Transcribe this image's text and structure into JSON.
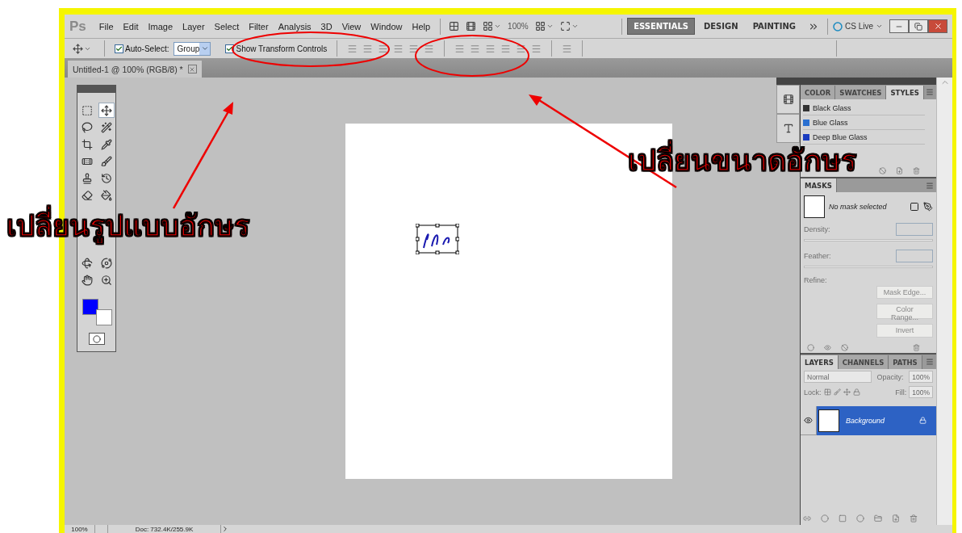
{
  "menu_bar": {
    "logo": "Ps",
    "items": [
      "File",
      "Edit",
      "Image",
      "Layer",
      "Select",
      "Filter",
      "Analysis",
      "3D",
      "View",
      "Window",
      "Help"
    ],
    "zoom": "100%",
    "workspaces": [
      {
        "label": "ESSENTIALS",
        "selected": true
      },
      {
        "label": "DESIGN",
        "selected": false
      },
      {
        "label": "PAINTING",
        "selected": false
      }
    ],
    "cs_live": "CS Live"
  },
  "options_bar": {
    "auto_select": {
      "label": "Auto-Select:",
      "checked": true,
      "value": "Group"
    },
    "show_transform_controls": {
      "label": "Show Transform Controls",
      "checked": true
    }
  },
  "document_tab": {
    "title": "Untitled-1 @ 100% (RGB/8) *"
  },
  "toolbox": {
    "swatches": [
      {
        "kind": "foreground",
        "color": "#0000ff"
      },
      {
        "kind": "background",
        "color": "#ffffff"
      }
    ]
  },
  "styles_panel": {
    "tabs": [
      {
        "label": "COLOR",
        "selected": false
      },
      {
        "label": "SWATCHES",
        "selected": false
      },
      {
        "label": "STYLES",
        "selected": true
      }
    ],
    "items": [
      {
        "label": "Black Glass",
        "color": "#333333"
      },
      {
        "label": "Blue Glass",
        "color": "#2a6fd0"
      },
      {
        "label": "Deep Blue Glass",
        "color": "#1a3cc0"
      }
    ]
  },
  "masks_panel": {
    "title": "MASKS",
    "status": "No mask selected",
    "density_label": "Density:",
    "feather_label": "Feather:",
    "refine_label": "Refine:",
    "buttons": [
      "Mask Edge...",
      "Color Range...",
      "Invert"
    ]
  },
  "layers_panel": {
    "tabs": [
      {
        "label": "LAYERS",
        "selected": true
      },
      {
        "label": "CHANNELS",
        "selected": false
      },
      {
        "label": "PATHS",
        "selected": false
      }
    ],
    "blend_mode": "Normal",
    "opacity_label": "Opacity:",
    "opacity": "100%",
    "lock_label": "Lock:",
    "fill_label": "Fill:",
    "fill": "100%",
    "layers": [
      {
        "name": "Background",
        "selected": true,
        "visible": true,
        "locked": true
      }
    ]
  },
  "status_bar": {
    "zoom": "100%",
    "doc_info": "Doc: 732.4K/255.9K"
  },
  "annotations": [
    {
      "kind": "left",
      "text": "เปลี่ยนรูปแบบอักษร"
    },
    {
      "kind": "right",
      "text": "เปลี่ยนขนาดอักษร"
    }
  ]
}
